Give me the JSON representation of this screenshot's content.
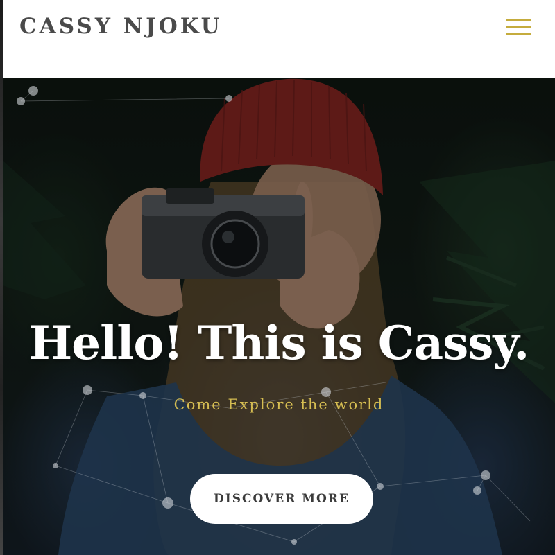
{
  "header": {
    "logo_text": "CASSY NJOKU",
    "menu_icon": "hamburger-menu-icon"
  },
  "hero": {
    "title": "Hello! This is Cassy.",
    "subtitle": "Come Explore the world",
    "cta_label": "DISCOVER MORE"
  },
  "colors": {
    "accent_gold": "#c5ac3d",
    "subtitle_gold": "#d6be52",
    "logo_text": "#4a4a4a",
    "hero_text": "#ffffff",
    "button_bg": "#ffffff",
    "button_text": "#3b3b3b"
  }
}
